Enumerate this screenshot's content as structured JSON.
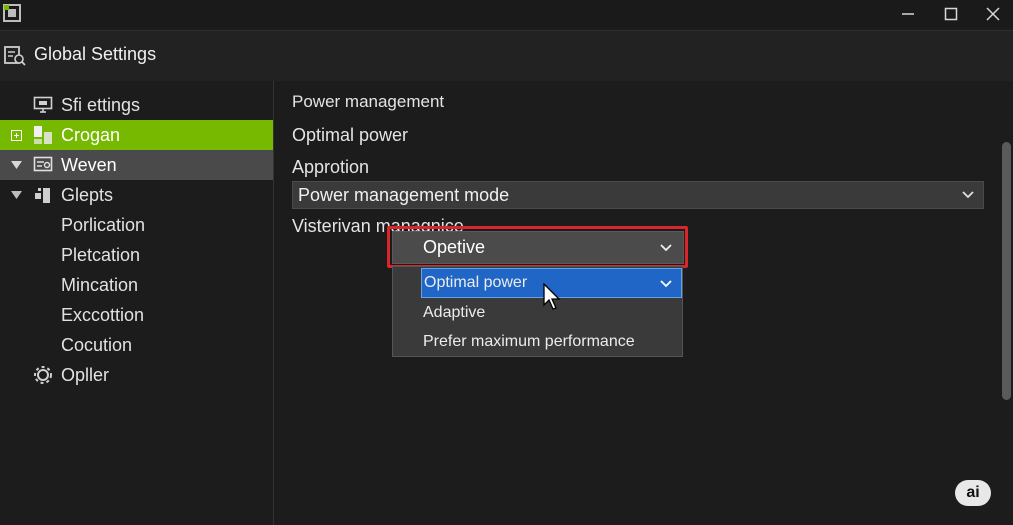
{
  "window": {
    "title": "Global Settings",
    "controls": {
      "minimize": "minimize-icon",
      "maximize": "maximize-icon",
      "close": "close-icon"
    }
  },
  "sidebar": {
    "items": [
      {
        "label": "Sfi ettings",
        "icon": "monitor-icon",
        "state": "normal",
        "expander": "none"
      },
      {
        "label": "Crogan",
        "icon": "grid-icon",
        "state": "selected",
        "expander": "collapsed"
      },
      {
        "label": "Weven",
        "icon": "display-settings-icon",
        "state": "hover",
        "expander": "expanded"
      },
      {
        "label": "Glepts",
        "icon": "puzzle-icon",
        "state": "normal",
        "expander": "expanded"
      },
      {
        "label": "Porlication",
        "icon": "",
        "state": "normal",
        "expander": "none"
      },
      {
        "label": "Pletcation",
        "icon": "",
        "state": "normal",
        "expander": "none"
      },
      {
        "label": "Mincation",
        "icon": "",
        "state": "normal",
        "expander": "none"
      },
      {
        "label": "Exccottion",
        "icon": "",
        "state": "normal",
        "expander": "none"
      },
      {
        "label": "Cocution",
        "icon": "",
        "state": "normal",
        "expander": "none"
      },
      {
        "label": "Opller",
        "icon": "gear-icon",
        "state": "normal",
        "expander": "none"
      }
    ]
  },
  "main": {
    "heading": "Power management",
    "line1": "Optimal power",
    "line2": "Approtion",
    "mode_select": {
      "value": "Power management mode"
    },
    "setting_label": "Visterivan managnice",
    "dropdown": {
      "selected": "Opetive",
      "options": [
        {
          "label": "Optimal power",
          "active": true
        },
        {
          "label": "Adaptive",
          "active": false
        },
        {
          "label": "Prefer maximum performance",
          "active": false
        }
      ]
    }
  },
  "badge": {
    "text": "ai"
  },
  "colors": {
    "accent": "#76b900",
    "highlight_border": "#d9262a",
    "active_option": "#1f66c7"
  }
}
